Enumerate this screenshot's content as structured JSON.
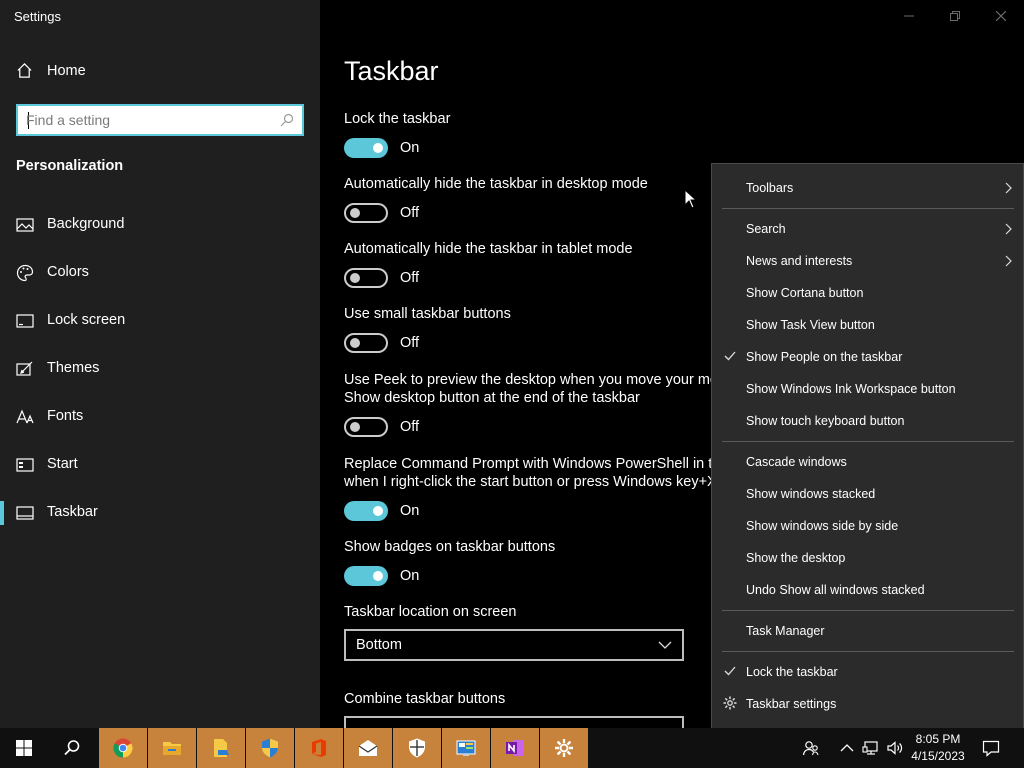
{
  "window": {
    "title": "Settings",
    "controls": {
      "minimize_icon": "minimize-icon",
      "maximize_icon": "restore-icon",
      "close_icon": "close-icon"
    }
  },
  "sidebar": {
    "home_label": "Home",
    "search_placeholder": "Find a setting",
    "section_title": "Personalization",
    "items": [
      {
        "label": "Background",
        "icon": "image-icon"
      },
      {
        "label": "Colors",
        "icon": "palette-icon"
      },
      {
        "label": "Lock screen",
        "icon": "lock-screen-icon"
      },
      {
        "label": "Themes",
        "icon": "themes-icon"
      },
      {
        "label": "Fonts",
        "icon": "fonts-icon"
      },
      {
        "label": "Start",
        "icon": "start-icon"
      },
      {
        "label": "Taskbar",
        "icon": "taskbar-icon",
        "active": true
      }
    ],
    "accent_color": "#5cc7d8"
  },
  "main": {
    "title": "Taskbar",
    "settings": [
      {
        "label": "Lock the taskbar",
        "state": "On"
      },
      {
        "label": "Automatically hide the taskbar in desktop mode",
        "state": "Off"
      },
      {
        "label": "Automatically hide the taskbar in tablet mode",
        "state": "Off"
      },
      {
        "label": "Use small taskbar buttons",
        "state": "Off"
      },
      {
        "label_line1": "Use Peek to preview the desktop when you move your mou",
        "label_line2": "Show desktop button at the end of the taskbar",
        "state": "Off"
      },
      {
        "label_line1": "Replace Command Prompt with Windows PowerShell in the",
        "label_line2": "when I right-click the start button or press Windows key+X",
        "state": "On"
      },
      {
        "label": "Show badges on taskbar buttons",
        "state": "On"
      }
    ],
    "location_label": "Taskbar location on screen",
    "location_value": "Bottom",
    "combine_label": "Combine taskbar buttons"
  },
  "context_menu": {
    "items": [
      {
        "label": "Toolbars",
        "submenu": true
      },
      {
        "label": "Search",
        "submenu": true
      },
      {
        "label": "News and interests",
        "submenu": true
      },
      {
        "label": "Show Cortana button"
      },
      {
        "label": "Show Task View button"
      },
      {
        "label": "Show People on the taskbar",
        "checked": true
      },
      {
        "label": "Show Windows Ink Workspace button"
      },
      {
        "label": "Show touch keyboard button"
      },
      {
        "label": "Cascade windows"
      },
      {
        "label": "Show windows stacked"
      },
      {
        "label": "Show windows side by side"
      },
      {
        "label": "Show the desktop"
      },
      {
        "label": "Undo Show all windows stacked"
      },
      {
        "label": "Task Manager"
      },
      {
        "label": "Lock the taskbar",
        "checked": true
      },
      {
        "label": "Taskbar settings",
        "icon": "gear-icon"
      }
    ]
  },
  "taskbar": {
    "apps": [
      "start-icon",
      "search-icon",
      "chrome-icon",
      "file-explorer-icon",
      "file-share-icon",
      "security-shield-icon",
      "office-icon",
      "mail-icon",
      "windows-security-icon",
      "control-panel-icon",
      "onenote-icon",
      "settings-gear-icon"
    ],
    "clock": {
      "time": "8:05 PM",
      "date": "4/15/2023"
    },
    "pinned_color": "#c7823c"
  }
}
